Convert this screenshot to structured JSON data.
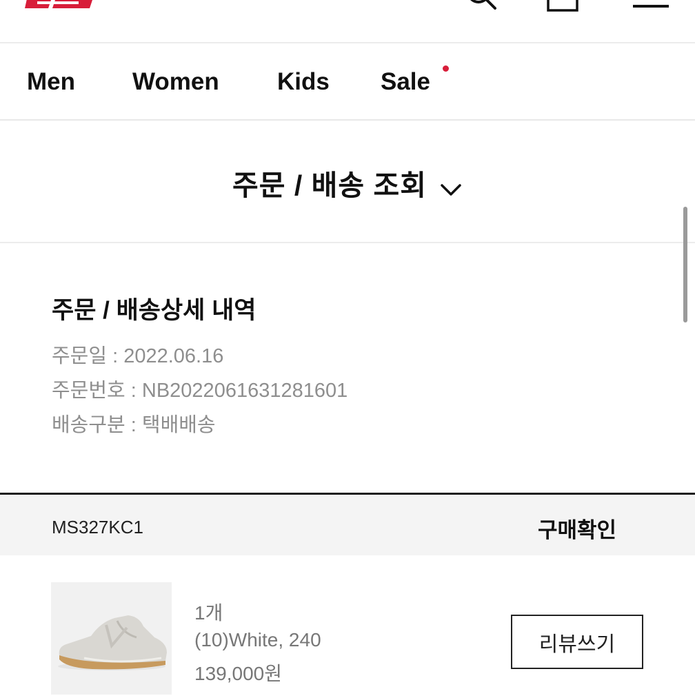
{
  "brand": {
    "logo_color": "#d81e3a"
  },
  "header": {
    "icons": [
      "search-icon",
      "bag-icon",
      "menu-icon"
    ]
  },
  "nav": {
    "items": [
      {
        "label": "Men"
      },
      {
        "label": "Women"
      },
      {
        "label": "Kids"
      },
      {
        "label": "Sale",
        "badge_dot": true
      }
    ],
    "badge_color": "#d81e3a"
  },
  "section": {
    "title": "주문 / 배송 조회",
    "dropdown_icon": "chevron-down-icon"
  },
  "order_detail": {
    "title": "주문 / 배송상세 내역",
    "order_date": "주문일 : 2022.06.16",
    "order_number": "주문번호 : NB2022061631281601",
    "delivery_type": "배송구분 : 택배배송"
  },
  "product": {
    "code": "MS327KC1",
    "status": "구매확인",
    "quantity": "1개",
    "option": "(10)White, 240",
    "price": "139,000원",
    "review_button": "리뷰쓰기"
  }
}
